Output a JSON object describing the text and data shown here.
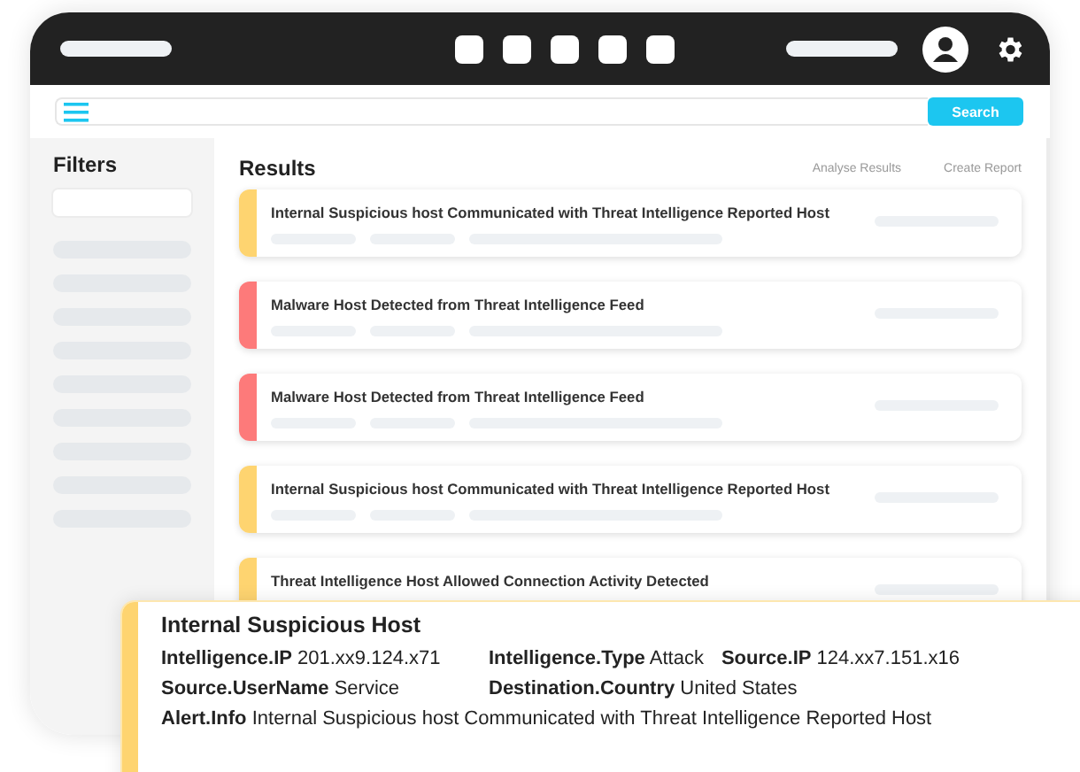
{
  "search": {
    "button": "Search"
  },
  "sidebar": {
    "title": "Filters"
  },
  "results": {
    "title": "Results",
    "actions": [
      "Analyse Results",
      "Create Report"
    ],
    "items": [
      {
        "title": "Internal Suspicious host Communicated with Threat Intelligence Reported Host",
        "color": "#fed470"
      },
      {
        "title": "Malware Host Detected from Threat Intelligence Feed",
        "color": "#fd7a7a"
      },
      {
        "title": "Malware Host Detected from Threat Intelligence Feed",
        "color": "#fd7a7a"
      },
      {
        "title": "Internal Suspicious host Communicated with Threat Intelligence Reported Host",
        "color": "#fed470"
      },
      {
        "title": "Threat Intelligence Host Allowed Connection Activity Detected",
        "color": "#fed470"
      }
    ]
  },
  "detail": {
    "title": "Internal Suspicious Host",
    "color": "#fed470",
    "rows": [
      [
        {
          "label": "Intelligence.IP",
          "value": "201.xx9.124.x71"
        },
        {
          "label": "Intelligence.Type",
          "value": "Attack"
        },
        {
          "label": "Source.IP",
          "value": "124.xx7.151.x16"
        }
      ],
      [
        {
          "label": "Source.UserName",
          "value": "Service"
        },
        {
          "label": "Destination.Country",
          "value": "United States"
        }
      ],
      [
        {
          "label": "Alert.Info",
          "value": "Internal Suspicious host Communicated with Threat Intelligence Reported Host"
        }
      ]
    ]
  }
}
